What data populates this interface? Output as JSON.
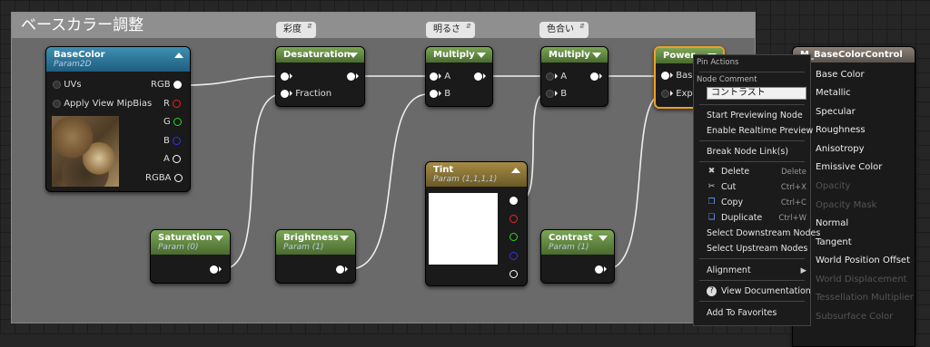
{
  "comment": {
    "title": "ベースカラー調整"
  },
  "bubbles": {
    "saturation": "彩度",
    "brightness": "明るさ",
    "hue": "色合い"
  },
  "nodes": {
    "basecolor": {
      "title": "BaseColor",
      "subtitle": "Param2D",
      "uvs": "UVs",
      "mip": "Apply View MipBias",
      "rgb": "RGB",
      "r": "R",
      "g": "G",
      "b": "B",
      "a": "A",
      "rgba": "RGBA"
    },
    "desaturation": {
      "title": "Desaturation",
      "fraction": "Fraction"
    },
    "multiply1": {
      "title": "Multiply",
      "a": "A",
      "b": "B"
    },
    "multiply2": {
      "title": "Multiply",
      "a": "A",
      "b": "B"
    },
    "power": {
      "title": "Power",
      "base": "Base",
      "exp": "Exp"
    },
    "tint": {
      "title": "Tint",
      "subtitle": "Param (1,1,1,1)"
    },
    "saturation": {
      "title": "Saturation",
      "subtitle": "Param (0)"
    },
    "brightness": {
      "title": "Brightness",
      "subtitle": "Param (1)"
    },
    "contrast": {
      "title": "Contrast",
      "subtitle": "Param (1)"
    }
  },
  "result": {
    "title": "M_BaseColorControl",
    "outputs": [
      "Base Color",
      "Metallic",
      "Specular",
      "Roughness",
      "Anisotropy",
      "Emissive Color",
      "Opacity",
      "Opacity Mask",
      "Normal",
      "Tangent",
      "World Position Offset",
      "World Displacement",
      "Tessellation Multiplier",
      "Subsurface Color"
    ]
  },
  "menu": {
    "pin_actions": "Pin Actions",
    "node_comment_label": "Node Comment",
    "node_comment_value": "コントラスト",
    "start_preview": "Start Previewing Node",
    "realtime_preview": "Enable Realtime Preview",
    "break_links": "Break Node Link(s)",
    "delete": "Delete",
    "delete_sc": "Delete",
    "cut": "Cut",
    "cut_sc": "Ctrl+X",
    "copy": "Copy",
    "copy_sc": "Ctrl+C",
    "duplicate": "Duplicate",
    "duplicate_sc": "Ctrl+W",
    "select_downstream": "Select Downstream Nodes",
    "select_upstream": "Select Upstream Nodes",
    "alignment": "Alignment",
    "view_docs": "View Documentation",
    "add_favorites": "Add To Favorites"
  }
}
